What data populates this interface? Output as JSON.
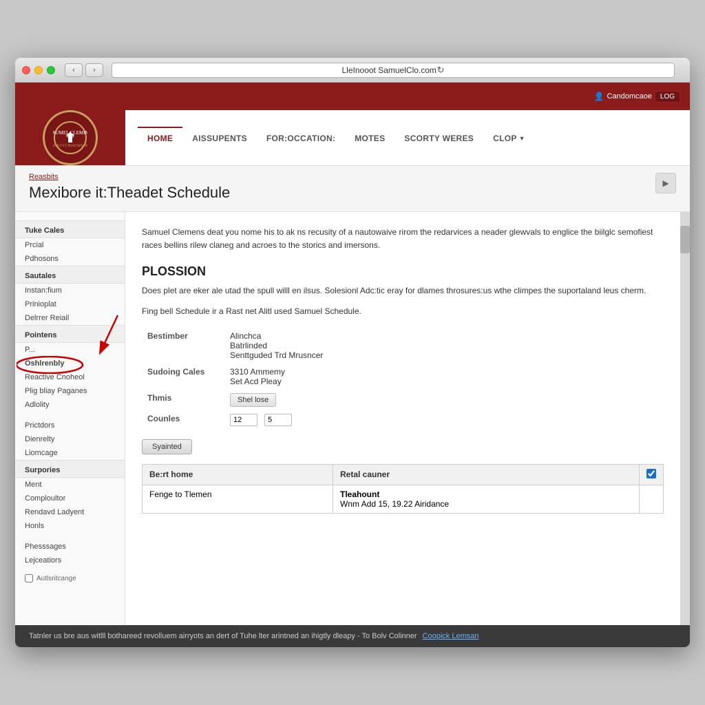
{
  "window": {
    "address_bar": "LleInooot SamuelClo.com",
    "traffic_lights": [
      "close",
      "minimize",
      "maximize"
    ]
  },
  "site_navbar": {
    "user_label": "Candomcaoe",
    "log_label": "LOG"
  },
  "header": {
    "logo_alt": "Caumel Clemins seal",
    "nav_items": [
      {
        "label": "HOME",
        "active": true
      },
      {
        "label": "AISSUPENTS",
        "active": false
      },
      {
        "label": "FOR:OCCATION:",
        "active": false
      },
      {
        "label": "MOTES",
        "active": false
      },
      {
        "label": "SCORTY WERES",
        "active": false
      },
      {
        "label": "CLOP",
        "active": false,
        "has_dropdown": true
      }
    ]
  },
  "page_header": {
    "breadcrumb": "Reasbits",
    "title": "Mexibore it:Theadet Schedule"
  },
  "sidebar": {
    "sections": [
      {
        "title": "Tuke Cales",
        "items": [
          "Prcial",
          "Pdhosons"
        ]
      },
      {
        "title": "Sautales",
        "items": [
          "Instan:fium",
          "Prinioplat",
          "Delrrer Reiail"
        ]
      },
      {
        "title": "Pointens",
        "items": [
          "P...",
          "Oshlrenbly"
        ]
      },
      {
        "items": [
          "Reactive Cnoheol",
          "Plig bliay Paganes",
          "Adlolity"
        ]
      },
      {
        "items": [
          "Prictdors",
          "Dienrelty",
          "Liomcage"
        ]
      },
      {
        "title": "Surpories",
        "items": [
          "Ment",
          "Comploultor",
          "Rendavd Ladyent",
          "Honls"
        ]
      },
      {
        "items": [
          "Phesssages",
          "Lejceatiors"
        ]
      }
    ],
    "highlighted_item": "Oshlrenbly",
    "autologon_label": "Autlsritcange"
  },
  "main": {
    "intro": "Samuel Clemens deat you nome his to ak ns recusity of a nautowaive rirom the redarvices a neader glewvals to englice the biilglc semofiest races bellins rilew claneg and acroes to the storics and imersons.",
    "section_title": "PLOSSION",
    "section_text1": "Does plet are eker ale utad the spull willl en ilsus. Solesionl Adc:tic eray for dlames throsures:us wthe climpes the suportaland leus cherm.",
    "section_text2": "Fing bell Schedule ir a Rast net Alitl used Samuel Schedule.",
    "form_fields": [
      {
        "label": "Bestimber",
        "value": "Alinchca\nBatrlinded\nSenitguded Trd Mrusncer"
      },
      {
        "label": "Sudoing Cales",
        "value": "3310 Ammemy\nSet Acd Pleay"
      },
      {
        "label": "Thmis",
        "value": "Shel lose"
      },
      {
        "label": "Counles",
        "value1": "12",
        "value2": "5"
      }
    ],
    "submit_btn": "Syainted",
    "table": {
      "headers": [
        "Be:rt home",
        "Retal cauner",
        "checkbox"
      ],
      "rows": [
        {
          "col1": "Fenge to Tlemen",
          "col2_title": "Tleahount",
          "col2_sub": "Wnm Add 15, 19.22 Airidance"
        }
      ]
    }
  },
  "footer": {
    "text": "Tatnler us bre aus witlll bothareed revolluem airryots an dert of Tuhe lter arintned an ihigtly dleapy - To Bolv Colinner",
    "link_label": "Coopick Lemsan"
  }
}
